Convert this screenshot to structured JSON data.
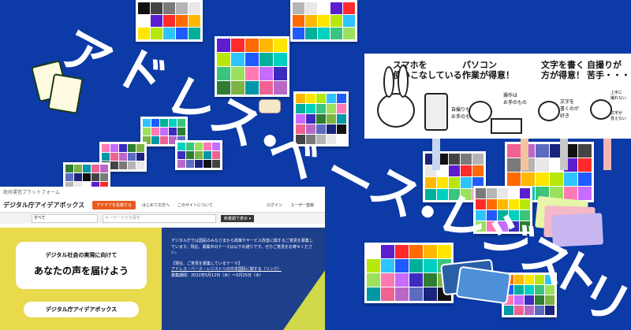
{
  "title_chars": [
    "ア",
    "ド",
    "レ",
    "ス",
    "・",
    "ベ",
    "ー",
    "ス",
    "・",
    "レ",
    "ジ",
    "ス",
    "ト",
    "リ"
  ],
  "palette_colors": [
    "#111111",
    "#444444",
    "#7a7a7a",
    "#b5b5b5",
    "#e8e8e8",
    "#ffffff",
    "#5b1ecf",
    "#ff2a2a",
    "#ff6a00",
    "#ffb800",
    "#ffe600",
    "#b7e80a",
    "#2ec4ff",
    "#1f5bff",
    "#00b09b",
    "#00d0c0",
    "#3ac47d",
    "#9be15d",
    "#ff7ab3",
    "#c86bff",
    "#3c2bbf",
    "#2e7d32",
    "#7cb342",
    "#0097a7",
    "#f06292",
    "#ba68c8",
    "#5c6bc0",
    "#1a237e"
  ],
  "idea_window": {
    "top_label": "政府運営プラットフォーム",
    "logo": "デジタル庁アイデアボックス",
    "post_button": "アイデアを投稿する",
    "nav": [
      "はじめての方へ",
      "このサイトについて"
    ],
    "login": "ログイン",
    "register": "ユーザー登録",
    "select": "すべて",
    "search_placeholder": "キーワードから探す",
    "sort_button": "新着順で表示 ▾",
    "hero_line1": "デジタル社会の実現に向けて",
    "hero_line2": "あなたの声を届けよう",
    "hero_badge": "デジタル庁アイデアボックス",
    "desc": "デジタル庁では国民のみなさまから政策やサービス改善に関するご意見を募集しています。現在、募集中のテーマは以下の通りです。ぜひご意見をお寄せください。",
    "theme_label": "【現在、ご意見を募集しているテーマ】",
    "theme": "アドレス・ベース・レジストリの日本国民に関する（リンク）",
    "period": "募集期間：2022年5月12日（木）〜5月25日（水）"
  },
  "illustration": {
    "heads": [
      "スマホを\n使いこなしている！",
      "パソコン\n作業が得意！",
      "文字を書く\n方が得意！",
      "自撮りが\n苦手・・・"
    ],
    "notes": [
      "自撮りも\nお手のもの！",
      "操作は\nお手のもの",
      "文字を\n書くのが\n好き",
      "上手に\n撮れない",
      "文字が\n見えない"
    ]
  }
}
